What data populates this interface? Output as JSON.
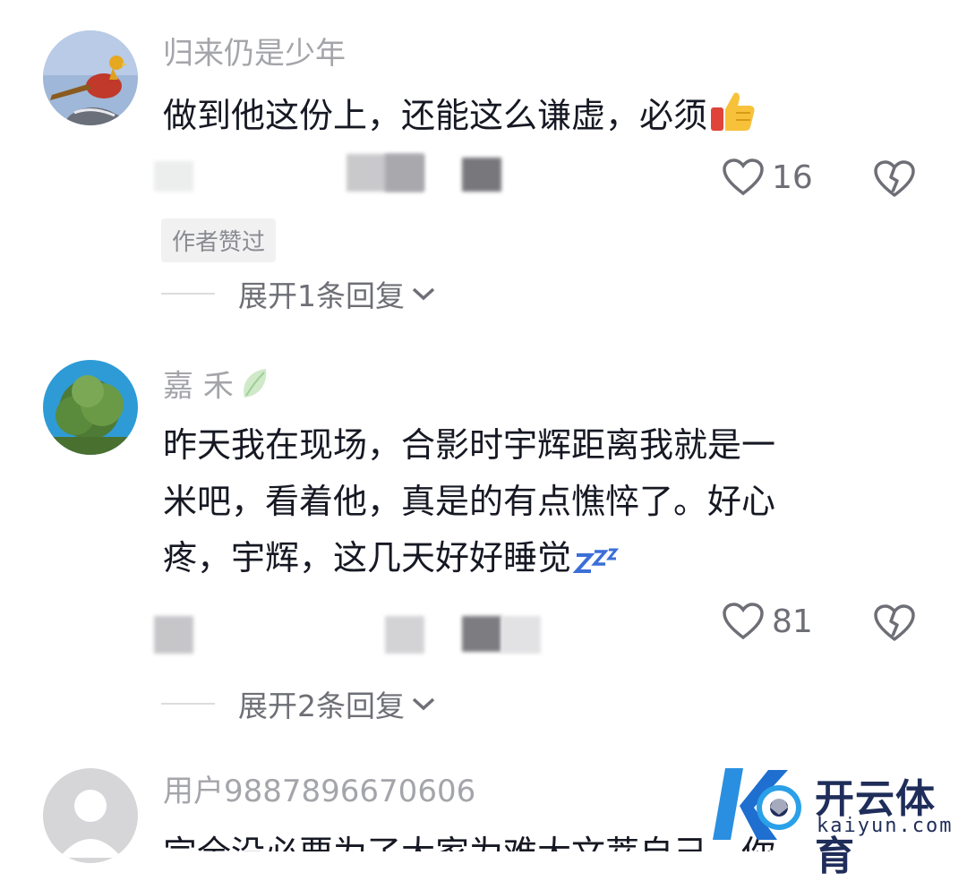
{
  "comments": [
    {
      "username": "归来仍是少年",
      "text": "做到他这份上，还能这么谦虚，必须",
      "emoji": "thumbs-up-icon",
      "likes": "16",
      "badge": "作者赞过",
      "expand_label": "展开1条回复"
    },
    {
      "username": "嘉 禾",
      "username_icon": "leaf-icon",
      "text_lines": [
        "昨天我在现场，合影时宇辉距离我就是一",
        "米吧，看着他，真是的有点憔悴了。好心",
        "疼，宇辉，这几天好好睡觉"
      ],
      "emoji": "zzz-icon",
      "likes": "81",
      "expand_label": "展开2条回复"
    },
    {
      "username": "用户9887896670606",
      "text": "完全没必要为了大家为难大文萃自己，你"
    }
  ],
  "watermark": {
    "brand_cn": "开云体育",
    "brand_en": "kaiyun.com"
  },
  "colors": {
    "username": "#a4a5aa",
    "text": "#161823",
    "secondary": "#6e6f76",
    "badge_bg": "#f1f1f2",
    "brand": "#1f2d5a"
  }
}
